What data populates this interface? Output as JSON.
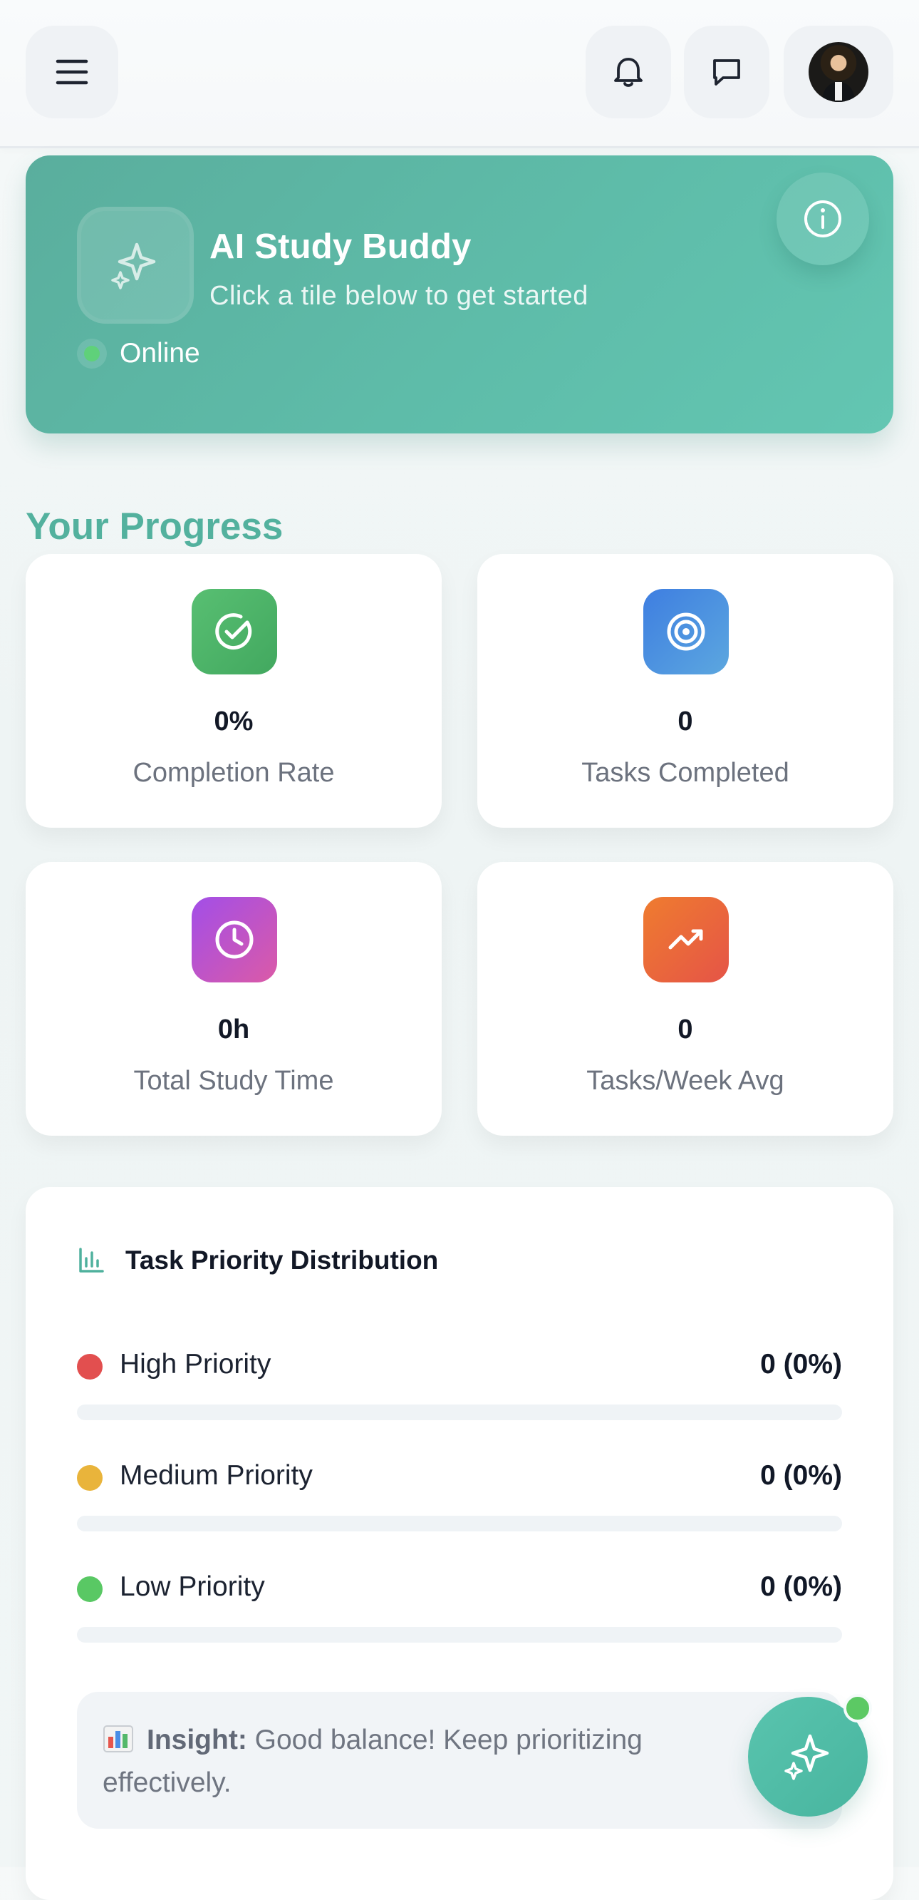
{
  "header": {
    "menu_icon": "menu-icon",
    "notification_icon": "bell-icon",
    "messages_icon": "chat-icon",
    "profile_icon": "avatar"
  },
  "assistant": {
    "title": "AI Study Buddy",
    "subtitle": "Click a tile below to get started",
    "status": "Online",
    "info_icon": "info-icon",
    "logo_icon": "sparkles-icon",
    "accent_color": "#5ebca9",
    "status_color": "#5fd17a"
  },
  "progress": {
    "title": "Your Progress",
    "stats": [
      {
        "value": "0%",
        "label": "Completion Rate",
        "icon": "check-circle-icon",
        "color": "#4bb467"
      },
      {
        "value": "0",
        "label": "Tasks Completed",
        "icon": "target-icon",
        "color": "#4b92df"
      },
      {
        "value": "0h",
        "label": "Total Study Time",
        "icon": "clock-icon",
        "color": "#bf56c8"
      },
      {
        "value": "0",
        "label": "Tasks/Week Avg",
        "icon": "trend-up-icon",
        "color": "#e9673c"
      }
    ]
  },
  "distribution": {
    "title": "Task Priority Distribution",
    "icon": "bar-chart-icon",
    "items": [
      {
        "label": "High Priority",
        "value": "0 (0%)",
        "fraction": 0,
        "color": "#e24f4f"
      },
      {
        "label": "Medium Priority",
        "value": "0 (0%)",
        "fraction": 0,
        "color": "#e9b43b"
      },
      {
        "label": "Low Priority",
        "value": "0 (0%)",
        "fraction": 0,
        "color": "#59c864"
      }
    ],
    "insight": {
      "icon": "bar-chart-emoji-icon",
      "label": "Insight:",
      "text": "Good balance! Keep prioritizing effectively."
    }
  },
  "floating_action": {
    "icon": "sparkles-icon",
    "badge_color": "#5cc964"
  }
}
